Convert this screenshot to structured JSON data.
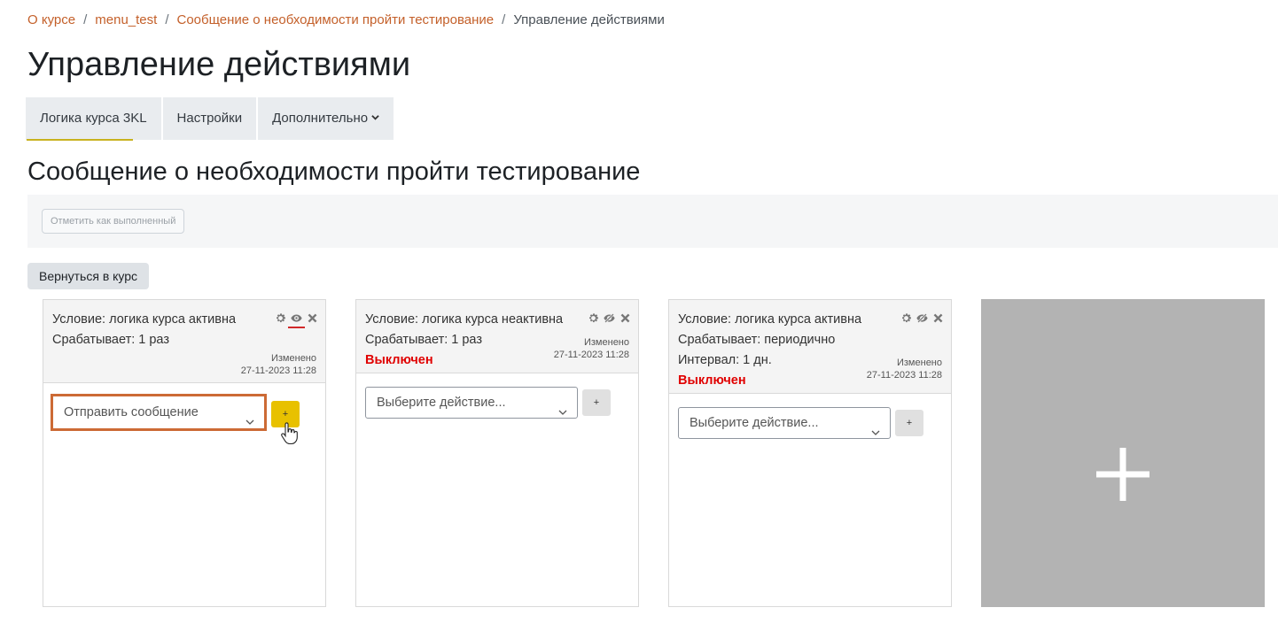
{
  "breadcrumb": {
    "items": [
      "О курсе",
      "menu_test",
      "Сообщение о необходимости пройти тестирование"
    ],
    "current": "Управление действиями",
    "separator": "/"
  },
  "page_title": "Управление действиями",
  "tabs": [
    {
      "label": "Логика курса 3KL"
    },
    {
      "label": "Настройки"
    },
    {
      "label": "Дополнительно"
    }
  ],
  "section_title": "Сообщение о необходимости пройти тестирование",
  "mark_done_label": "Отметить как выполненный",
  "back_button_label": "Вернуться в курс",
  "cards": [
    {
      "condition": "Условие: логика курса активна",
      "trigger": "Срабатывает: 1 раз",
      "modified_label": "Изменено",
      "modified_date": "27-11-2023 11:28",
      "select_value": "Отправить сообщение",
      "add_label": "+"
    },
    {
      "condition": "Условие: логика курса неактивна",
      "trigger": "Срабатывает: 1 раз",
      "status": "Выключен",
      "modified_label": "Изменено",
      "modified_date": "27-11-2023 11:28",
      "select_value": "Выберите действие...",
      "add_label": "+"
    },
    {
      "condition": "Условие: логика курса активна",
      "trigger": "Срабатывает: периодично",
      "interval": "Интервал: 1 дн.",
      "status": "Выключен",
      "modified_label": "Изменено",
      "modified_date": "27-11-2023 11:28",
      "select_value": "Выберите действие...",
      "add_label": "+"
    }
  ],
  "icons": [
    "gear-icon",
    "eye-icon",
    "eye-slash-icon",
    "close-icon",
    "chevron-down-icon",
    "plus-icon",
    "hand-cursor-icon"
  ],
  "colors": {
    "link": "#c4602a",
    "disabled_status": "#e00000",
    "highlight_border": "#cc6a35",
    "add_button_yellow": "#e8c100",
    "add_card_bg": "#b3b3b3",
    "tab_active_underline": "#c8b21e"
  }
}
